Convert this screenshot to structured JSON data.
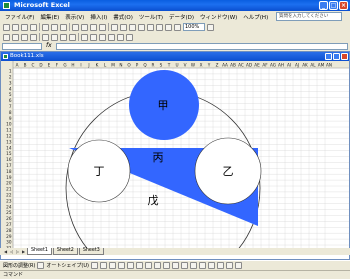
{
  "app": {
    "title": "Microsoft Excel"
  },
  "menu": [
    "ファイル(F)",
    "編集(E)",
    "表示(V)",
    "挿入(I)",
    "書式(O)",
    "ツール(T)",
    "データ(D)",
    "ウィンドウ(W)",
    "ヘルプ(H)"
  ],
  "ask_box": {
    "placeholder": "質問を入力してください"
  },
  "toolbar": {
    "zoom": "100%"
  },
  "formula_bar": {
    "fx": "fx"
  },
  "workbook": {
    "title": "Book111.xls"
  },
  "sheet": {
    "columns": [
      "A",
      "B",
      "C",
      "D",
      "E",
      "F",
      "G",
      "H",
      "I",
      "J",
      "K",
      "L",
      "M",
      "N",
      "O",
      "P",
      "Q",
      "R",
      "S",
      "T",
      "U",
      "V",
      "W",
      "X",
      "Y",
      "Z",
      "AA",
      "AB",
      "AC",
      "AD",
      "AE",
      "AF",
      "AG",
      "AH",
      "AI",
      "AJ",
      "AK",
      "AL",
      "AM",
      "AN"
    ],
    "rows": [
      "1",
      "2",
      "3",
      "4",
      "5",
      "6",
      "7",
      "8",
      "9",
      "10",
      "11",
      "12",
      "13",
      "14",
      "15",
      "16",
      "17",
      "18",
      "19",
      "20",
      "21",
      "22",
      "23",
      "24",
      "25",
      "26",
      "27",
      "28",
      "29",
      "30",
      "31",
      "32",
      "33"
    ]
  },
  "shapes": {
    "colors": {
      "blue": "#3366ff",
      "outline": "#333333",
      "fill_white": "#ffffff"
    },
    "labels": {
      "top_circle": "甲",
      "left_circle": "丁",
      "right_circle": "乙",
      "center": "丙",
      "bottom": "戊"
    }
  },
  "tabs": [
    "Sheet1",
    "Sheet2",
    "Sheet3"
  ],
  "draw_toolbar": {
    "draw_label": "図形の調整(R)",
    "autoshape_label": "オートシェイプ(U)"
  },
  "status": {
    "text": "コマンド"
  }
}
